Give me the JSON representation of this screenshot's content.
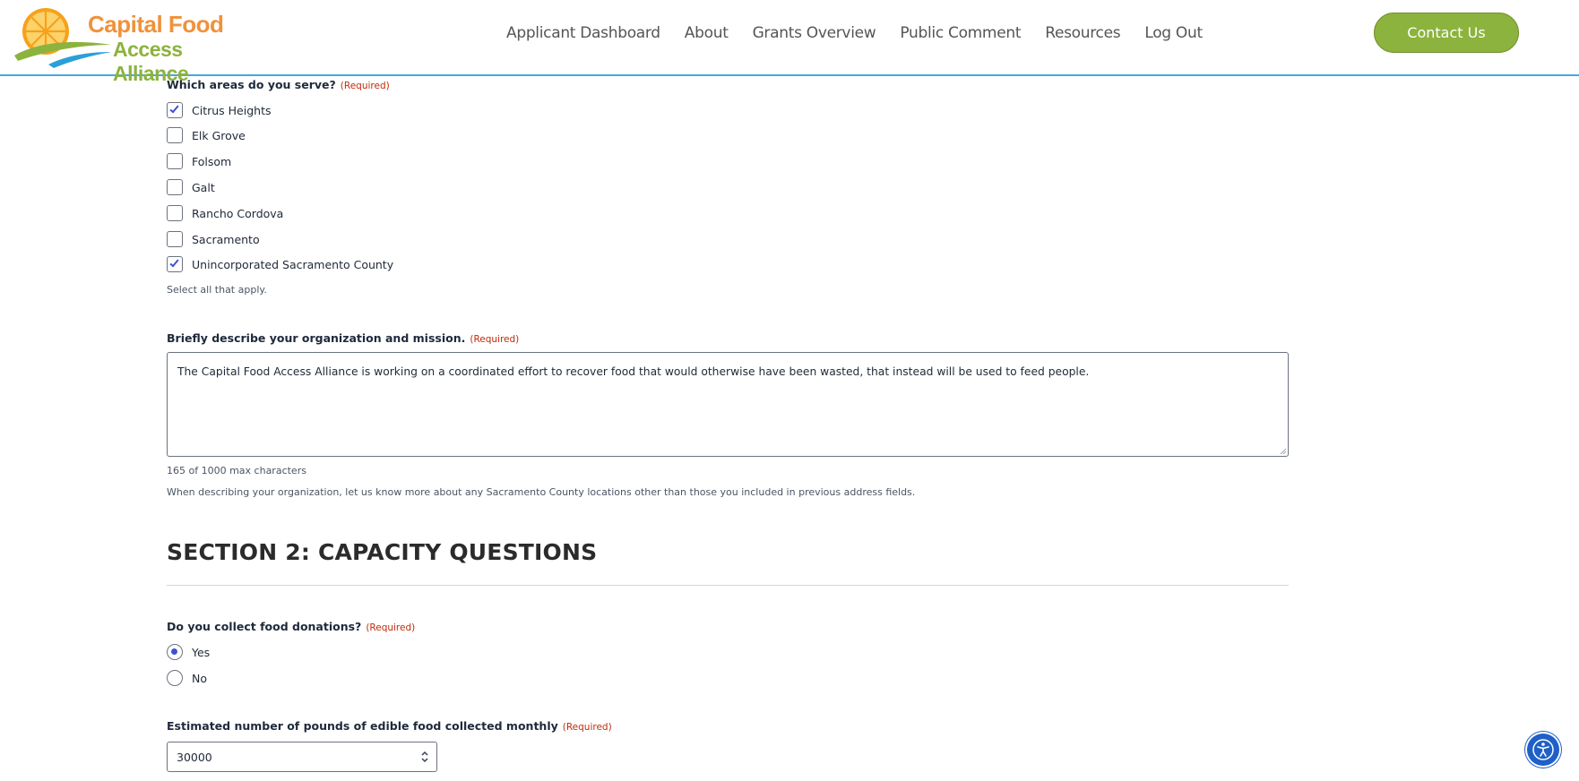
{
  "brand": {
    "line1": "Capital Food",
    "line2": "Access Alliance",
    "colors": {
      "orange": "#f0923a",
      "green": "#8cb33d",
      "blue": "#4aa6dc"
    }
  },
  "nav": {
    "items": [
      {
        "label": "Applicant Dashboard"
      },
      {
        "label": "About"
      },
      {
        "label": "Grants Overview"
      },
      {
        "label": "Public Comment"
      },
      {
        "label": "Resources"
      },
      {
        "label": "Log Out"
      }
    ],
    "contact_label": "Contact Us"
  },
  "form": {
    "required_text": "(Required)",
    "areas": {
      "label": "Which areas do you serve?",
      "options": [
        {
          "label": "Citrus Heights",
          "checked": true
        },
        {
          "label": "Elk Grove",
          "checked": false
        },
        {
          "label": "Folsom",
          "checked": false
        },
        {
          "label": "Galt",
          "checked": false
        },
        {
          "label": "Rancho Cordova",
          "checked": false
        },
        {
          "label": "Sacramento",
          "checked": false
        },
        {
          "label": "Unincorporated Sacramento County",
          "checked": true
        }
      ],
      "help": "Select all that apply."
    },
    "mission": {
      "label": "Briefly describe your organization and mission.",
      "value": "The Capital Food Access Alliance is working on a coordinated effort to recover food that would otherwise have been wasted, that instead will be used to feed people.",
      "counter": "165 of 1000 max characters",
      "help": "When describing your organization, let us know more about any Sacramento County locations other than those you included in previous address fields."
    },
    "section2_title": "SECTION 2: CAPACITY QUESTIONS",
    "donations": {
      "label": "Do you collect food donations?",
      "options": [
        {
          "label": "Yes",
          "selected": true
        },
        {
          "label": "No",
          "selected": false
        }
      ]
    },
    "pounds": {
      "label": "Estimated number of pounds of edible food collected monthly",
      "value": "30000"
    }
  },
  "icons": {
    "logo": "orange-slice-logo-icon",
    "accessibility": "accessibility-person-icon",
    "checkmark": "checkmark-icon",
    "spinner": "number-spinner-icon"
  }
}
